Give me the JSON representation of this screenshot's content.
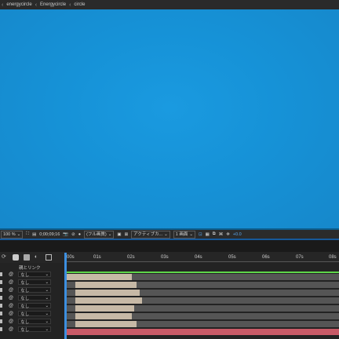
{
  "breadcrumb": [
    "energycircle",
    "Energycircle",
    "circle"
  ],
  "viewer": {
    "background_color": "#1591d6"
  },
  "viewer_bar": {
    "zoom": "100 %",
    "timecode": "0;00;09;16",
    "resolution": "(フル画質)",
    "camera": "アクティブカ...",
    "views": "1 画面",
    "exposure": "+0.0"
  },
  "timeline": {
    "parent_header": "親とリンク",
    "ruler_ticks": [
      "00s",
      "01s",
      "02s",
      "03s",
      "04s",
      "05s",
      "06s",
      "07s",
      "08s"
    ],
    "layers": [
      {
        "parent": "なし",
        "light_end": 0.24
      },
      {
        "parent": "なし",
        "light_end": 0.26
      },
      {
        "parent": "なし",
        "light_end": 0.27
      },
      {
        "parent": "なし",
        "light_end": 0.28
      },
      {
        "parent": "なし",
        "light_end": 0.25
      },
      {
        "parent": "なし",
        "light_end": 0.24
      },
      {
        "parent": "なし",
        "light_end": 0.26
      },
      {
        "parent": "なし",
        "light_end": 0.0
      }
    ],
    "playhead_color": "#3c8fe0",
    "work_area_color": "#5fd64a",
    "last_bar_color": "#c85a67"
  }
}
